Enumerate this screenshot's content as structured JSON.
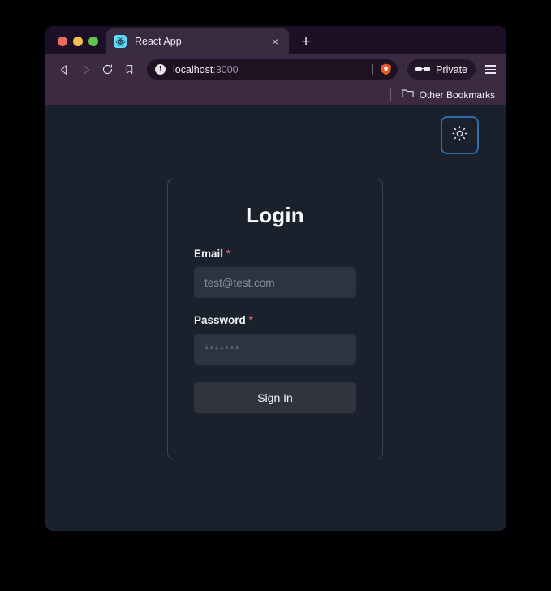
{
  "browser": {
    "window_controls": [
      "close",
      "minimize",
      "maximize"
    ],
    "tab": {
      "title": "React App",
      "favicon": "react-logo-icon",
      "close_label": "×"
    },
    "new_tab_label": "+",
    "toolbar": {
      "back_icon": "back-arrow-icon",
      "forward_icon": "forward-arrow-icon",
      "reload_icon": "reload-icon",
      "bookmark_icon": "bookmark-icon",
      "url_host": "localhost",
      "url_port": ":3000",
      "url_info_icon": "not-secure-info-icon",
      "info_glyph": "!",
      "shield_icon": "brave-shield-icon",
      "private_label": "Private",
      "private_icon": "sunglasses-icon",
      "menu_icon": "hamburger-menu-icon"
    },
    "bookmarks_bar": {
      "folder_icon": "folder-icon",
      "other_bookmarks_label": "Other Bookmarks"
    }
  },
  "page": {
    "theme_toggle": {
      "icon": "sun-brightness-icon",
      "border_color": "#2f6ead"
    },
    "login": {
      "title": "Login",
      "email": {
        "label": "Email",
        "required_mark": "*",
        "placeholder": "test@test.com",
        "value": ""
      },
      "password": {
        "label": "Password",
        "required_mark": "*",
        "placeholder": "*******",
        "value": ""
      },
      "submit_label": "Sign In"
    },
    "colors": {
      "background": "#1a202c",
      "card_border": "#3c4454",
      "input_background": "#2d3340",
      "button_background": "#2f343f",
      "required_asterisk": "#f1706f",
      "accent_blue": "#2f6ead"
    }
  }
}
